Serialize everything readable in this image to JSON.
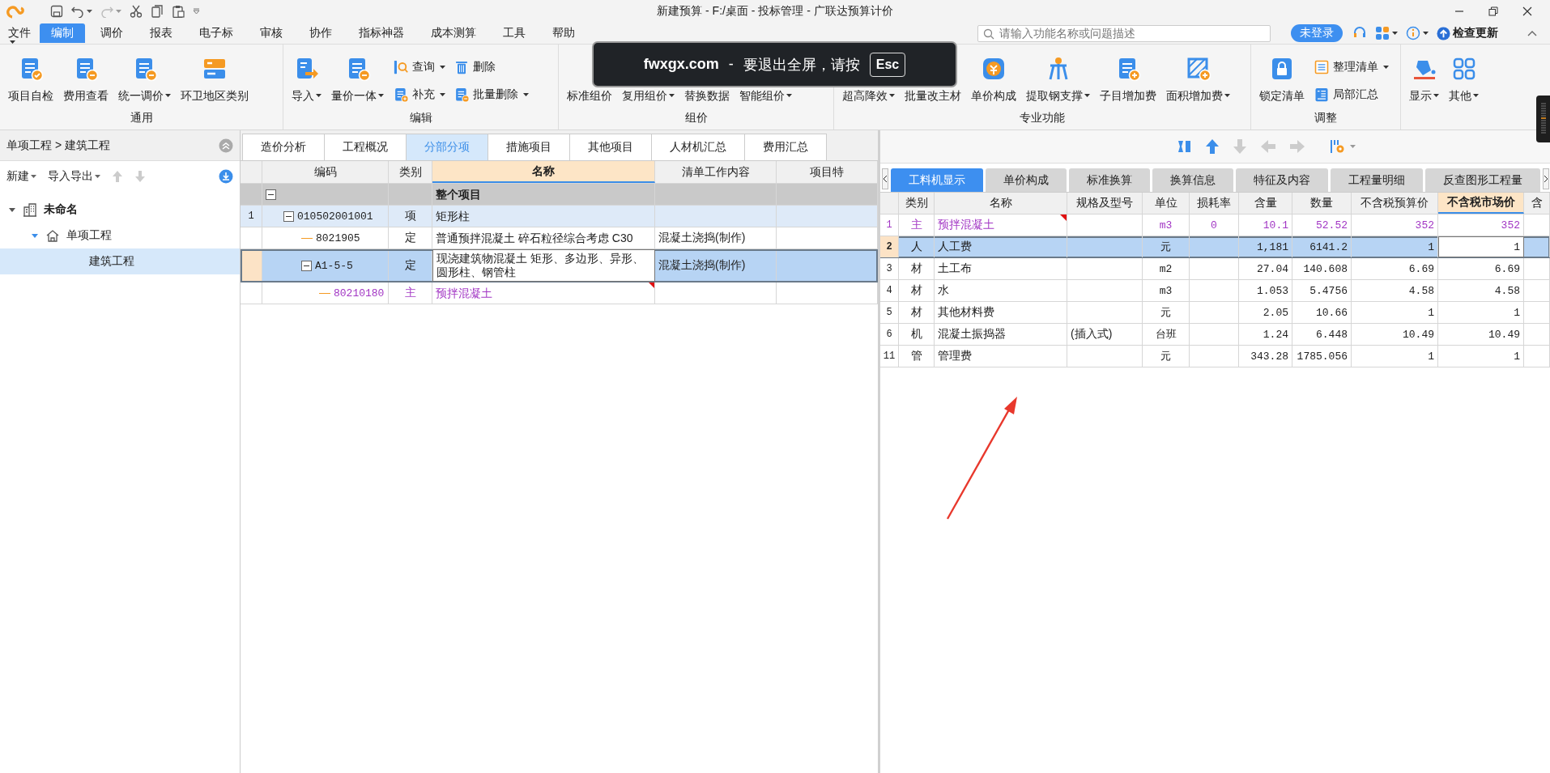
{
  "window": {
    "title": "新建预算 - F:/桌面 - 投标管理 - 广联达预算计价"
  },
  "menu": [
    {
      "label": "文件",
      "dropdown": true,
      "selected": false
    },
    {
      "label": "编制",
      "dropdown": false,
      "selected": true
    },
    {
      "label": "调价",
      "dropdown": false,
      "selected": false
    },
    {
      "label": "报表",
      "dropdown": false,
      "selected": false
    },
    {
      "label": "电子标",
      "dropdown": false,
      "selected": false
    },
    {
      "label": "审核",
      "dropdown": false,
      "selected": false
    },
    {
      "label": "协作",
      "dropdown": false,
      "selected": false
    },
    {
      "label": "指标神器",
      "dropdown": false,
      "selected": false
    },
    {
      "label": "成本测算",
      "dropdown": false,
      "selected": false
    },
    {
      "label": "工具",
      "dropdown": false,
      "selected": false
    },
    {
      "label": "帮助",
      "dropdown": false,
      "selected": false
    }
  ],
  "search": {
    "placeholder": "请输入功能名称或问题描述"
  },
  "account": {
    "login": "未登录",
    "update": "检查更新"
  },
  "ribbon": [
    {
      "label": "通用",
      "buttons": [
        {
          "label": "项目自检",
          "kind": "large",
          "dropdown": false
        },
        {
          "label": "费用查看",
          "kind": "large",
          "dropdown": false
        },
        {
          "label": "统一调价",
          "kind": "large",
          "dropdown": true
        },
        {
          "label": "环卫地区类别",
          "kind": "large",
          "dropdown": false
        }
      ]
    },
    {
      "label": "编辑",
      "buttons": [
        {
          "label": "导入",
          "kind": "large",
          "dropdown": true
        },
        {
          "label": "量价一体",
          "kind": "large",
          "dropdown": true
        },
        {
          "label": "查询",
          "kind": "small",
          "dropdown": true
        },
        {
          "label": "补充",
          "kind": "small",
          "dropdown": true
        },
        {
          "label": "删除",
          "kind": "small",
          "dropdown": false
        },
        {
          "label": "批量删除",
          "kind": "small",
          "dropdown": true
        }
      ]
    },
    {
      "label": "组价",
      "buttons": [
        {
          "label": "标准组价",
          "kind": "large",
          "dropdown": false
        },
        {
          "label": "复用组价",
          "kind": "large",
          "dropdown": true
        },
        {
          "label": "替换数据",
          "kind": "large",
          "dropdown": false
        },
        {
          "label": "智能组价",
          "kind": "large",
          "dropdown": true
        }
      ]
    },
    {
      "label": "专业功能",
      "buttons": [
        {
          "label": "超高降效",
          "kind": "large",
          "dropdown": true
        },
        {
          "label": "批量改主材",
          "kind": "large",
          "dropdown": false
        },
        {
          "label": "单价构成",
          "kind": "large",
          "dropdown": false
        },
        {
          "label": "提取钢支撑",
          "kind": "large",
          "dropdown": true
        },
        {
          "label": "子目增加费",
          "kind": "large",
          "dropdown": false
        },
        {
          "label": "面积增加费",
          "kind": "large",
          "dropdown": true
        }
      ]
    },
    {
      "label": "调整",
      "buttons": [
        {
          "label": "锁定清单",
          "kind": "large",
          "dropdown": false
        },
        {
          "label": "整理清单",
          "kind": "small",
          "dropdown": true
        },
        {
          "label": "局部汇总",
          "kind": "small",
          "dropdown": false
        }
      ]
    },
    {
      "buttons": [
        {
          "label": "显示",
          "kind": "large",
          "dropdown": true
        },
        {
          "label": "其他",
          "kind": "large",
          "dropdown": true
        }
      ]
    }
  ],
  "overlay": {
    "site": "fwxgx.com",
    "separator": "-",
    "message": "要退出全屏，请按",
    "key": "Esc"
  },
  "left": {
    "breadcrumb": "单项工程 > 建筑工程",
    "toolbar": [
      {
        "label": "新建"
      },
      {
        "label": "导入导出"
      }
    ],
    "tree": [
      {
        "label": "未命名",
        "expanded": true,
        "selected": false,
        "children": [
          {
            "label": "单项工程",
            "expanded": true,
            "selected": false,
            "children": [
              {
                "label": "建筑工程",
                "selected": true
              }
            ]
          }
        ]
      }
    ]
  },
  "middle": {
    "tabs": [
      {
        "label": "造价分析",
        "selected": false
      },
      {
        "label": "工程概况",
        "selected": false
      },
      {
        "label": "分部分项",
        "selected": true
      },
      {
        "label": "措施项目",
        "selected": false
      },
      {
        "label": "其他项目",
        "selected": false
      },
      {
        "label": "人材机汇总",
        "selected": false
      },
      {
        "label": "费用汇总",
        "selected": false
      }
    ],
    "table": {
      "columns": [
        {
          "label": "编码",
          "highlighted": false
        },
        {
          "label": "类别",
          "highlighted": false
        },
        {
          "label": "名称",
          "highlighted": true
        },
        {
          "label": "清单工作内容",
          "highlighted": false
        },
        {
          "label": "项目特",
          "highlighted": false
        }
      ],
      "rows": [
        {
          "name": "整个项目",
          "kind": "section",
          "expanded": true,
          "selected": false,
          "note_mark": false,
          "children": [
            {
              "number": "1",
              "code": "010502001001",
              "type": "项",
              "name": "矩形柱",
              "kind": "list",
              "expanded": true,
              "selected": false,
              "note_mark": false,
              "children": [
                {
                  "code": "8021905",
                  "type": "定",
                  "name": "普通预拌混凝土 碎石粒径综合考虑 C30",
                  "content": "混凝土浇捣(制作)",
                  "kind": "quota",
                  "selected": false,
                  "note_mark": false
                },
                {
                  "code": "A1-5-5",
                  "type": "定",
                  "name": "现浇建筑物混凝土 矩形、多边形、异形、圆形柱、钢管柱",
                  "content": "混凝土浇捣(制作)",
                  "kind": "quota",
                  "expanded": true,
                  "selected": true,
                  "note_mark": false,
                  "children": [
                    {
                      "code": "80210180",
                      "type": "主",
                      "name": "预拌混凝土",
                      "kind": "material",
                      "selected": false,
                      "note_mark": true
                    }
                  ]
                }
              ]
            }
          ]
        }
      ]
    }
  },
  "right": {
    "tabs": [
      {
        "label": "工料机显示",
        "selected": true
      },
      {
        "label": "单价构成",
        "selected": false
      },
      {
        "label": "标准换算",
        "selected": false
      },
      {
        "label": "换算信息",
        "selected": false
      },
      {
        "label": "特征及内容",
        "selected": false
      },
      {
        "label": "工程量明细",
        "selected": false
      },
      {
        "label": "反查图形工程量",
        "selected": false
      }
    ],
    "table": {
      "columns": [
        {
          "label": "类别",
          "highlighted": false
        },
        {
          "label": "名称",
          "highlighted": false
        },
        {
          "label": "规格及型号",
          "highlighted": false
        },
        {
          "label": "单位",
          "highlighted": false
        },
        {
          "label": "损耗率",
          "highlighted": false
        },
        {
          "label": "含量",
          "highlighted": false
        },
        {
          "label": "数量",
          "highlighted": false
        },
        {
          "label": "不含税预算价",
          "highlighted": false
        },
        {
          "label": "不含税市场价",
          "highlighted": true
        },
        {
          "label": "含",
          "highlighted": false
        }
      ],
      "rows": [
        {
          "number": "1",
          "category": "主",
          "name": "预拌混凝土",
          "unit": "m3",
          "loss": "0",
          "content": "10.1",
          "quantity": "52.52",
          "budget_price": "352",
          "market_price": "352",
          "kind": "main",
          "selected": false,
          "note_mark": true
        },
        {
          "number": "2",
          "category": "人",
          "name": "人工费",
          "unit": "元",
          "content": "1,181",
          "quantity": "6141.2",
          "budget_price": "1",
          "market_price": "1",
          "kind": "labor",
          "selected": true,
          "note_mark": false
        },
        {
          "number": "3",
          "category": "材",
          "name": "土工布",
          "unit": "m2",
          "content": "27.04",
          "quantity": "140.608",
          "budget_price": "6.69",
          "market_price": "6.69",
          "kind": "material",
          "selected": false,
          "note_mark": false
        },
        {
          "number": "4",
          "category": "材",
          "name": "水",
          "unit": "m3",
          "content": "1.053",
          "quantity": "5.4756",
          "budget_price": "4.58",
          "market_price": "4.58",
          "kind": "material",
          "selected": false,
          "note_mark": false
        },
        {
          "number": "5",
          "category": "材",
          "name": "其他材料费",
          "unit": "元",
          "content": "2.05",
          "quantity": "10.66",
          "budget_price": "1",
          "market_price": "1",
          "kind": "material",
          "selected": false,
          "note_mark": false
        },
        {
          "number": "6",
          "category": "机",
          "name": "混凝土振捣器",
          "spec": "(插入式)",
          "unit": "台班",
          "content": "1.24",
          "quantity": "6.448",
          "budget_price": "10.49",
          "market_price": "10.49",
          "kind": "machine",
          "selected": false,
          "note_mark": false
        },
        {
          "number": "11",
          "category": "管",
          "name": "管理费",
          "unit": "元",
          "content": "343.28",
          "quantity": "1785.056",
          "budget_price": "1",
          "market_price": "1",
          "kind": "management",
          "selected": false,
          "note_mark": false
        }
      ]
    }
  }
}
